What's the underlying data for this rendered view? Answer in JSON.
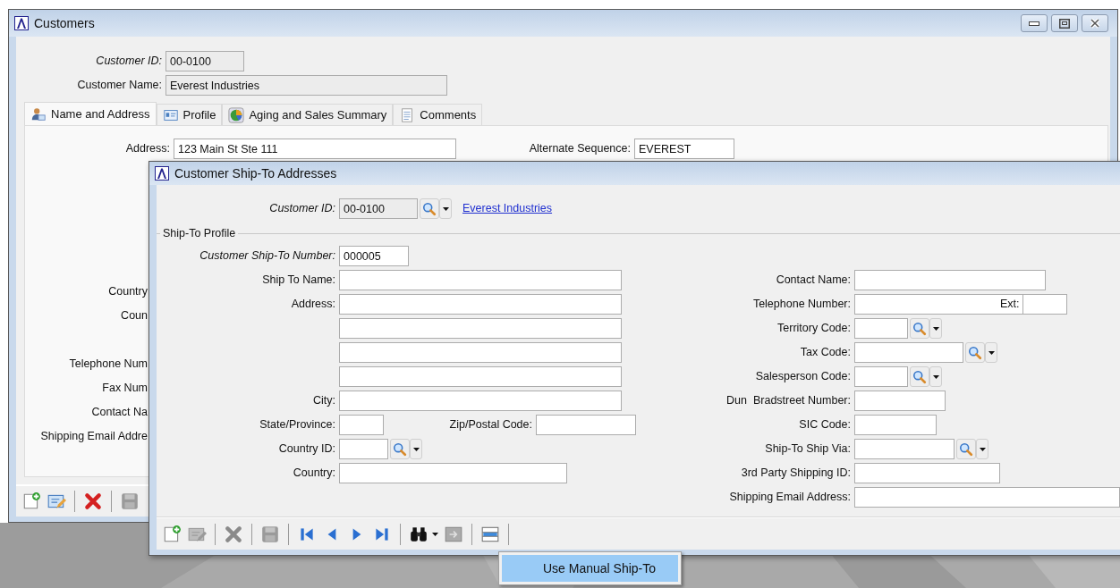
{
  "customers_window": {
    "title": "Customers",
    "customer_id": {
      "label": "Customer ID:",
      "value": "00-0100",
      "key": true,
      "disabled": true
    },
    "customer_name": {
      "label": "Customer Name:",
      "value": "Everest Industries",
      "key": false,
      "disabled": true
    },
    "tabs": [
      {
        "label": "Name and Address",
        "selected": true
      },
      {
        "label": "Profile",
        "selected": false
      },
      {
        "label": "Aging and Sales Summary",
        "selected": false
      },
      {
        "label": "Comments",
        "selected": false
      }
    ],
    "address": {
      "label": "Address:",
      "value": "123 Main St Ste 111"
    },
    "alternate_sequence": {
      "label": "Alternate Sequence:",
      "value": "EVEREST"
    },
    "partly_hidden_labels": [
      "Country",
      "Coun",
      "Telephone Num",
      "Fax Num",
      "Contact Na",
      "Shipping Email Addre"
    ],
    "toolbar": [
      {
        "kind": "new",
        "disabled": false
      },
      {
        "kind": "edit",
        "disabled": false
      },
      {
        "kind": "separator"
      },
      {
        "kind": "delete",
        "disabled": false
      },
      {
        "kind": "separator"
      },
      {
        "kind": "save",
        "disabled": true
      }
    ]
  },
  "ship_to_window": {
    "title": "Customer Ship-To Addresses",
    "customer_id": {
      "label": "Customer ID:",
      "value": "00-0100",
      "key": true,
      "disabled": true,
      "link": "Everest Industries"
    },
    "group_title": "Ship-To Profile",
    "left_fields": [
      {
        "kind": "text",
        "label": "Customer Ship-To Number:",
        "value": "000005",
        "key": true
      },
      {
        "kind": "text",
        "label": "Ship To Name:"
      },
      {
        "kind": "text",
        "label": "Address:"
      },
      {
        "kind": "text"
      },
      {
        "kind": "text"
      },
      {
        "kind": "text"
      },
      {
        "kind": "text",
        "label": "City:"
      },
      {
        "kind": "pair",
        "label": "State/Province:",
        "second_label": "Zip/Postal Code:"
      },
      {
        "kind": "lookup",
        "label": "Country ID:"
      },
      {
        "kind": "text",
        "label": "Country:"
      }
    ],
    "right_fields": [
      {
        "kind": "text",
        "label": "Contact Name:"
      },
      {
        "kind": "phone",
        "label": "Telephone Number:",
        "ext_label": "Ext:"
      },
      {
        "kind": "lookup",
        "label": "Territory Code:"
      },
      {
        "kind": "lookup",
        "label": "Tax Code:"
      },
      {
        "kind": "lookup",
        "label": "Salesperson Code:"
      },
      {
        "kind": "text",
        "label": "Dun  Bradstreet Number:"
      },
      {
        "kind": "text",
        "label": "SIC Code:"
      },
      {
        "kind": "lookup",
        "label": "Ship-To Ship Via:"
      },
      {
        "kind": "text",
        "label": "3rd Party Shipping ID:"
      },
      {
        "kind": "text",
        "label": "Shipping Email Address:"
      }
    ],
    "toolbar": [
      {
        "kind": "new",
        "disabled": false
      },
      {
        "kind": "edit",
        "disabled": true
      },
      {
        "kind": "separator"
      },
      {
        "kind": "delete",
        "disabled": true
      },
      {
        "kind": "separator"
      },
      {
        "kind": "save",
        "disabled": true
      },
      {
        "kind": "separator"
      },
      {
        "kind": "first",
        "disabled": false
      },
      {
        "kind": "previous",
        "disabled": false
      },
      {
        "kind": "next",
        "disabled": false
      },
      {
        "kind": "last",
        "disabled": false
      },
      {
        "kind": "separator"
      },
      {
        "kind": "find",
        "disabled": false
      },
      {
        "kind": "transfer",
        "disabled": true
      },
      {
        "kind": "separator"
      },
      {
        "kind": "list",
        "disabled": false
      },
      {
        "kind": "separator"
      }
    ]
  },
  "context_menu": {
    "items": [
      {
        "label": "Use Manual Ship-To",
        "selected": true
      }
    ]
  }
}
